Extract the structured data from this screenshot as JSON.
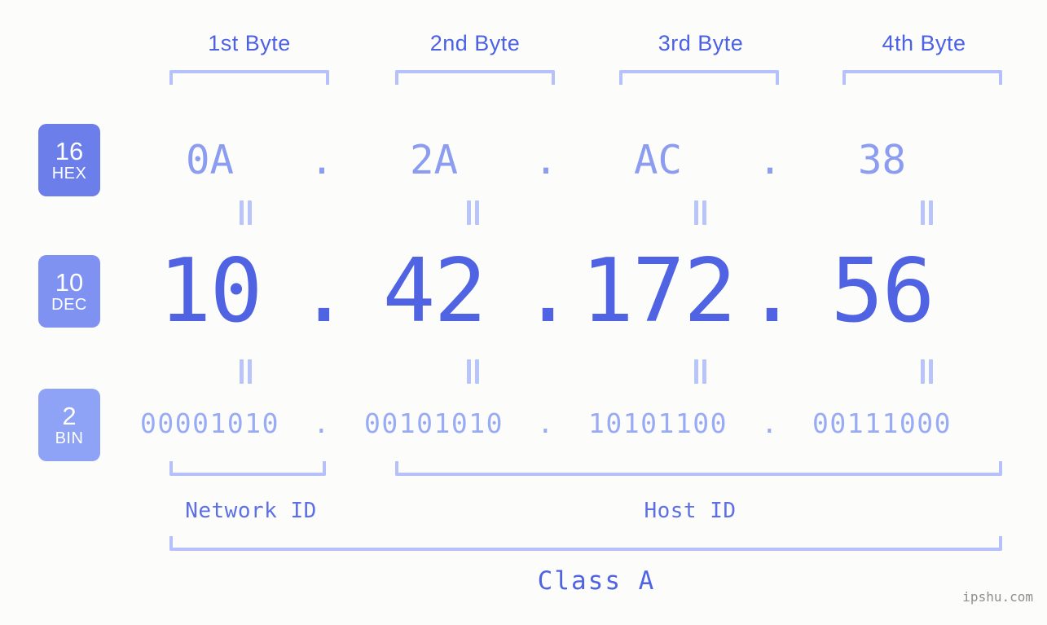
{
  "meta": {
    "watermark": "ipshu.com",
    "background": "#fcfdfa",
    "accent_strong": "#4f63e3",
    "accent_mid": "#8b9cf1",
    "accent_light": "#9aabf5",
    "bracket_color": "#b6c1fb"
  },
  "headers": {
    "byte1": "1st Byte",
    "byte2": "2nd Byte",
    "byte3": "3rd Byte",
    "byte4": "4th Byte"
  },
  "bases": {
    "hex": {
      "radix": "16",
      "name": "HEX",
      "color": "#6c7eea"
    },
    "dec": {
      "radix": "10",
      "name": "DEC",
      "color": "#7f92f2"
    },
    "bin": {
      "radix": "2",
      "name": "BIN",
      "color": "#8fa3f6"
    }
  },
  "separator": ".",
  "rows": {
    "hex": {
      "octets": [
        "0A",
        "2A",
        "AC",
        "38"
      ]
    },
    "dec": {
      "octets": [
        "10",
        "42",
        "172",
        "56"
      ]
    },
    "bin": {
      "octets": [
        "00001010",
        "00101010",
        "10101100",
        "00111000"
      ]
    }
  },
  "equals_glyph": "||",
  "sections": {
    "network_id": "Network ID",
    "host_id": "Host ID",
    "class": "Class A"
  },
  "address": {
    "dotted_decimal": "10.42.172.56",
    "dotted_hex": "0A.2A.AC.38",
    "dotted_binary": "00001010.00101010.10101100.00111000",
    "class": "A",
    "network_bytes": 1,
    "host_bytes": 3
  }
}
